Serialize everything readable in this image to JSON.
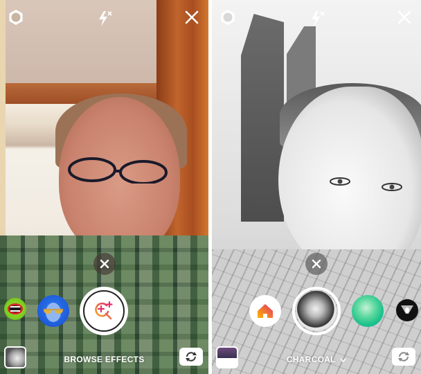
{
  "screens": [
    {
      "id": "browse",
      "top_bar": {
        "settings_icon": "gear-icon",
        "flash_icon": "flash-off-icon",
        "close_icon": "close-icon"
      },
      "dismiss_icon": "close-icon",
      "effects": [
        {
          "name": "mouth-effect",
          "icon": "open-mouth-icon"
        },
        {
          "name": "sunglasses-effect",
          "icon": "aviator-sunglasses-icon"
        }
      ],
      "shutter_icon": "browse-effects-icon",
      "label": "BROWSE EFFECTS",
      "gallery_icon": "gallery-thumbnail",
      "flip_icon": "flip-camera-icon"
    },
    {
      "id": "charcoal",
      "top_bar": {
        "settings_icon": "gear-icon",
        "flash_icon": "flash-off-icon",
        "close_icon": "close-icon"
      },
      "dismiss_icon": "close-icon",
      "effects": [
        {
          "name": "home-effect",
          "icon": "home-icon"
        },
        {
          "name": "charcoal-effect",
          "icon": "charcoal-sphere-icon",
          "selected": true
        },
        {
          "name": "green-glow-effect",
          "icon": "green-glow-icon"
        },
        {
          "name": "spotlight-effect",
          "icon": "spotlight-icon"
        }
      ],
      "label": "CHARCOAL",
      "label_icon": "chevron-down-icon",
      "gallery_icon": "gallery-thumbnail",
      "flip_icon": "flip-camera-icon"
    }
  ],
  "colors": {
    "accent_gradient_start": "#f5a623",
    "accent_gradient_end": "#e1306c",
    "home_gradient_start": "#ffb400",
    "home_gradient_end": "#e1306c",
    "green_effect": "#2ecc71",
    "blue_effect": "#1f5fe0"
  }
}
